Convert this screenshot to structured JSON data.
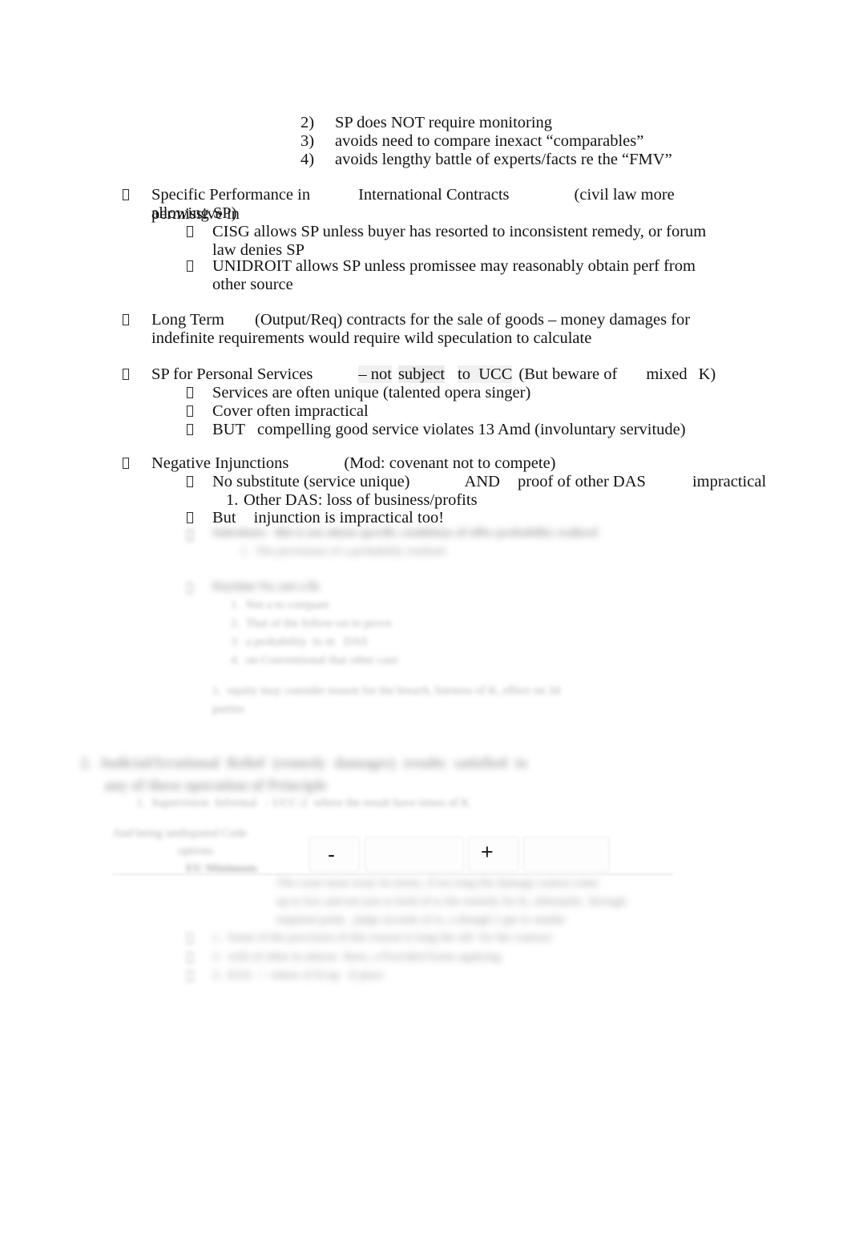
{
  "document": {
    "kind": "outline-notes-page",
    "page_background": "#ffffff",
    "text_color": "#131313",
    "highlight_color": "#ececec",
    "redacted_text_color": "#8d8d8d"
  },
  "numbered_list": {
    "items": [
      {
        "marker": "2)",
        "text": "SP does NOT require monitoring"
      },
      {
        "marker": "3)",
        "text": "avoids need to compare inexact “comparables”"
      },
      {
        "marker": "4)",
        "text": "avoids lengthy battle of experts/facts re the “FMV”"
      }
    ]
  },
  "sections": [
    {
      "id": "international-contracts",
      "bullet": "tofu-box-bullet",
      "heading_run_1": "Specific Performance in",
      "heading_run_2": "International Contracts",
      "heading_run_3": "(civil law more permissive in",
      "heading_line_2": "allowing SP)",
      "subitems": [
        {
          "bullet": "tofu-box-bullet",
          "line1": "CISG allows SP unless buyer has resorted to inconsistent remedy, or forum",
          "line2": "law denies SP"
        },
        {
          "bullet": "tofu-box-bullet",
          "line1": "UNIDROIT allows SP unless promissee may reasonably obtain perf from",
          "line2": "other source"
        }
      ]
    },
    {
      "id": "long-term-contracts",
      "bullet": "tofu-box-bullet",
      "run_1": "Long Term",
      "run_2": "(Output/Req) contracts for the sale of goods – money damages for",
      "line_2": "indefinite requirements would require wild speculation to calculate"
    },
    {
      "id": "personal-services",
      "bullet": "tofu-box-bullet",
      "run_1": "SP for Personal Services",
      "run_2": "– not",
      "run_3_highlighted": "subject",
      "run_4_highlighted": "to  UCC",
      "run_5": "(But beware of",
      "run_6": "mixed",
      "run_7": "K)",
      "subitems": [
        {
          "bullet": "tofu-box-bullet",
          "text": "Services are often unique (talented opera singer)"
        },
        {
          "bullet": "tofu-box-bullet",
          "text": "Cover often impractical"
        },
        {
          "bullet": "tofu-box-bullet",
          "text": "BUT   compelling good service violates 13 Amd (involuntary servitude)"
        }
      ]
    },
    {
      "id": "negative-injunctions",
      "bullet": "tofu-box-bullet",
      "run_1": "Negative Injunctions",
      "run_2": "(Mod: covenant not to compete)",
      "subitems": [
        {
          "bullet": "tofu-box-bullet",
          "run_1": "No substitute (service unique)",
          "run_2": "AND",
          "run_3": "proof of other DAS",
          "run_4": "impractical",
          "numbered": [
            {
              "marker": "1.",
              "text": "Other DAS: loss of business/profits"
            }
          ]
        },
        {
          "bullet": "tofu-box-bullet",
          "run_1": "But",
          "run_2": "injunction is impractical too!"
        }
      ]
    }
  ],
  "redacted": {
    "note": "lower portion of the page is blurred/illegible in the source image",
    "blocks": [
      {
        "id": "blur-1",
        "lines": [
          "Substitute:  this is not about specific conditions of offer probability realized",
          "1.  The provisions of a probability realized"
        ]
      },
      {
        "id": "blur-2",
        "lines": [
          "Daytime No, not a lis",
          "1.  Not a to compare",
          "2.  That of the follow-on to prove",
          "3.  a probability  to in   DAS",
          "4.  on Conventional that other case"
        ]
      },
      {
        "id": "blur-3",
        "lines": [
          "1.  equity may consider reason for the breach, fairness of K, effect on 3d",
          "parties"
        ]
      },
      {
        "id": "blur-heading",
        "lines": [
          "2.  Judicial/Irrational  Relief  (remedy  damages)  results  satisfied  to",
          "any of these operation of Principle",
          "1.  Supervision  Informal   - UCC-2  where the result have times of K"
        ]
      },
      {
        "id": "blur-form-label",
        "lines": [
          "And being undisputed Code",
          "options",
          "EU Minimum"
        ]
      },
      {
        "id": "blur-4",
        "lines": [
          "The court must issue its terms, if too long the damage cannot come",
          "up to law and not just to hold of to the remedy for K, ultimately  through",
          "required point.  judge records of to, a though 2 get to enable",
          "1.  Some of the provision of this reason is long the old  for the contract",
          "2.  with of other in almost  there, a Provided forms applying",
          "3.  DAS  +  where of K/up   if place"
        ]
      }
    ],
    "form_strip": {
      "minus_sign": "-",
      "plus_sign": "+"
    }
  }
}
